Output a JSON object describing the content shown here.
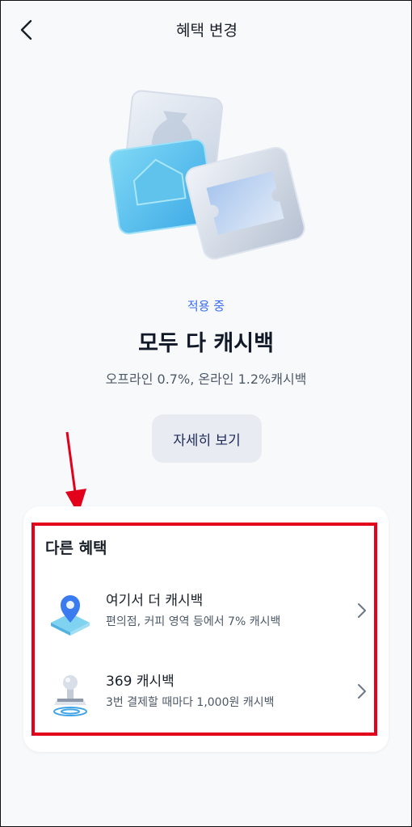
{
  "header": {
    "title": "혜택 변경",
    "back_icon": "chevron-left-icon"
  },
  "current": {
    "status": "적용 중",
    "name": "모두 다 캐시백",
    "description": "오프라인 0.7%, 온라인 1.2%캐시백",
    "detail_button": "자세히 보기"
  },
  "other": {
    "title": "다른 혜택",
    "items": [
      {
        "name": "여기서 더 캐시백",
        "sub": "편의점, 커피 영역 등에서 7% 캐시백",
        "icon": "location-pin-icon"
      },
      {
        "name": "369 캐시백",
        "sub": "3번 결제할 때마다 1,000원 캐시백",
        "icon": "stamp-icon"
      }
    ]
  },
  "colors": {
    "accent": "#3b6df0",
    "annotation": "#e3001b"
  }
}
